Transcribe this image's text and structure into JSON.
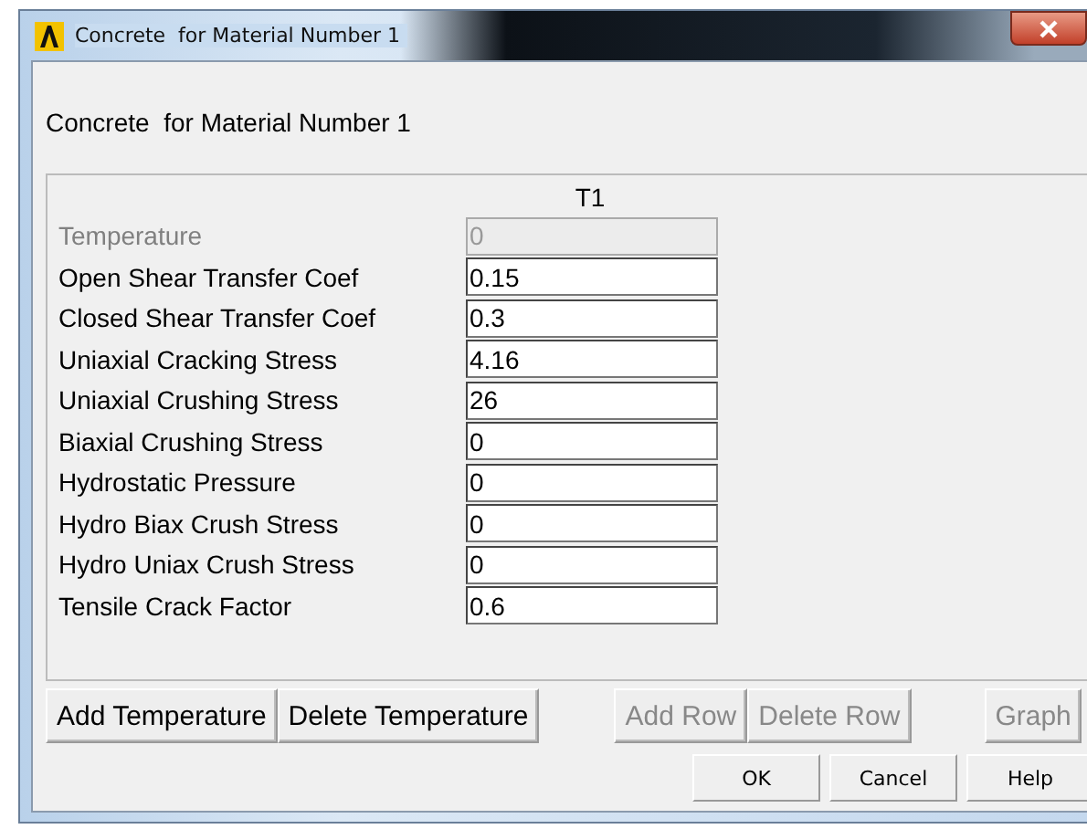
{
  "window": {
    "title": "Concrete  for Material Number 1"
  },
  "heading": "Concrete  for Material Number 1",
  "table": {
    "column": "T1",
    "rows": [
      {
        "label": "Temperature",
        "value": "0",
        "disabled": true
      },
      {
        "label": "Open Shear Transfer Coef",
        "value": "0.15",
        "disabled": false
      },
      {
        "label": "Closed Shear Transfer Coef",
        "value": "0.3",
        "disabled": false
      },
      {
        "label": "Uniaxial Cracking Stress",
        "value": "4.16",
        "disabled": false
      },
      {
        "label": "Uniaxial Crushing Stress",
        "value": "26",
        "disabled": false
      },
      {
        "label": "Biaxial Crushing Stress",
        "value": "0",
        "disabled": false
      },
      {
        "label": "Hydrostatic Pressure",
        "value": "0",
        "disabled": false
      },
      {
        "label": "Hydro Biax Crush Stress",
        "value": "0",
        "disabled": false
      },
      {
        "label": "Hydro Uniax Crush Stress",
        "value": "0",
        "disabled": false
      },
      {
        "label": "Tensile Crack Factor",
        "value": "0.6",
        "disabled": false
      }
    ]
  },
  "table_button_groups": [
    {
      "buttons": [
        {
          "label": "Add Temperature",
          "disabled": false
        },
        {
          "label": "Delete Temperature",
          "disabled": false
        }
      ]
    },
    {
      "buttons": [
        {
          "label": "Add Row",
          "disabled": true
        },
        {
          "label": "Delete Row",
          "disabled": true
        }
      ]
    },
    {
      "buttons": [
        {
          "label": "Graph",
          "disabled": true
        }
      ]
    }
  ],
  "dialog_buttons": [
    "OK",
    "Cancel",
    "Help"
  ]
}
